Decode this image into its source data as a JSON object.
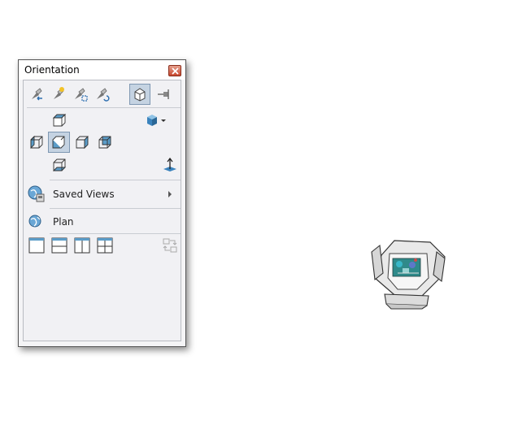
{
  "dialog": {
    "title": "Orientation",
    "toolbar_icons": [
      "previous-view-icon",
      "next-view-icon",
      "zoom-fit-icon",
      "rotate-reset-icon",
      "view-selector-icon",
      "pin-icon"
    ],
    "views": [
      "top-view-icon",
      "left-view-icon",
      "front-view-icon",
      "right-view-icon",
      "back-view-icon",
      "bottom-view-icon",
      "shaded-cube-icon",
      "normal-to-icon"
    ],
    "saved_views_label": "Saved Views",
    "plan_label": "Plan",
    "layout_icons": [
      "single-viewport-icon",
      "two-horizontal-viewports-icon",
      "two-vertical-viewports-icon",
      "four-viewports-icon",
      "link-views-icon"
    ]
  },
  "colors": {
    "active_view": "#5b9cc8",
    "cube_blue": "#3a83bd",
    "close_red": "#c8482f"
  }
}
